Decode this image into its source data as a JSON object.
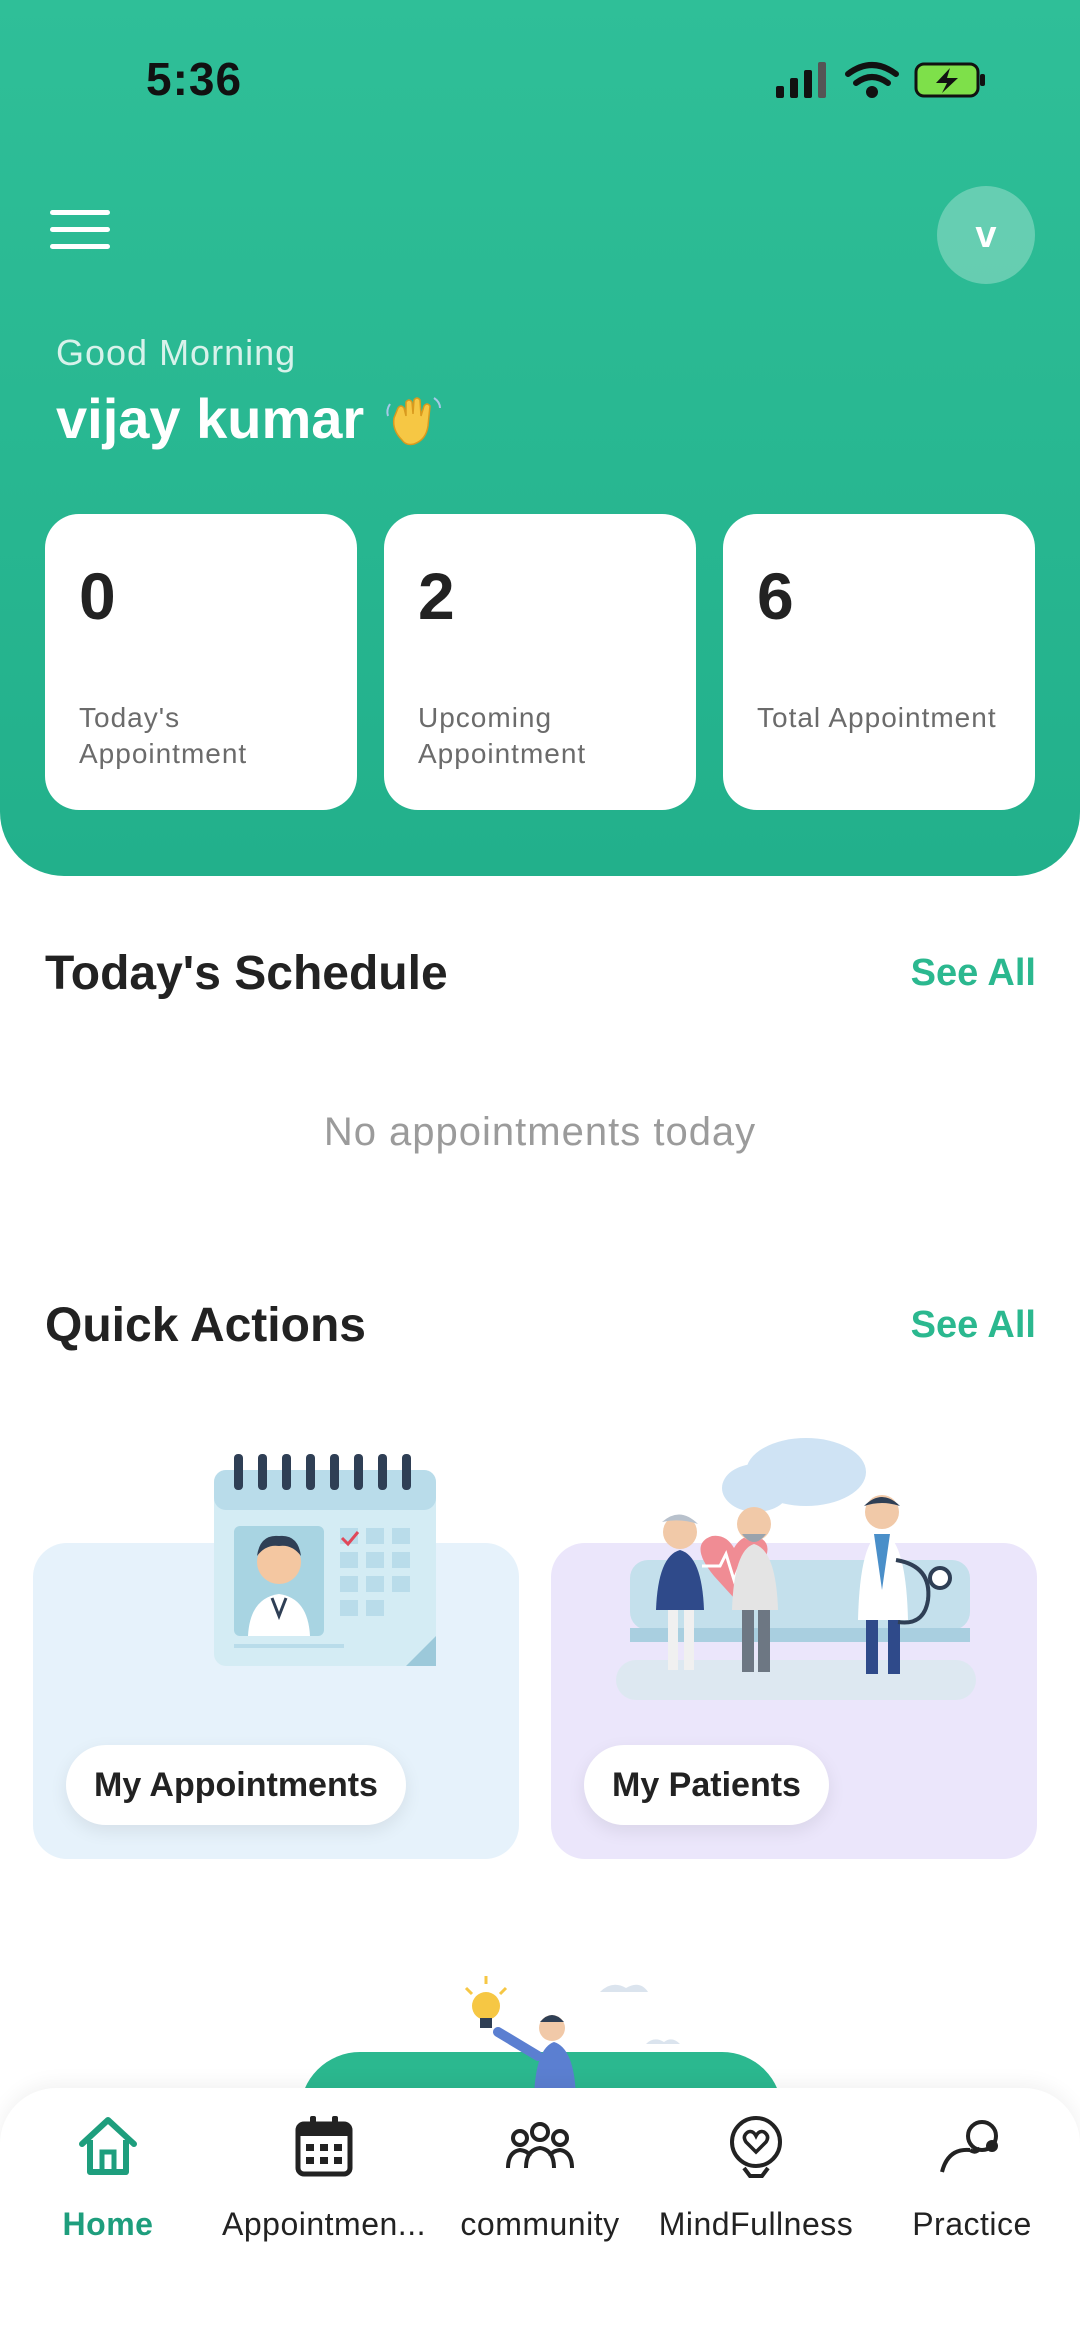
{
  "status": {
    "time": "5:36"
  },
  "header": {
    "avatar_initial": "v",
    "greeting": "Good Morning",
    "user_name": "vijay kumar"
  },
  "stats": [
    {
      "value": "0",
      "label": "Today's Appointment"
    },
    {
      "value": "2",
      "label": "Upcoming Appointment"
    },
    {
      "value": "6",
      "label": "Total Appointment"
    }
  ],
  "schedule": {
    "title": "Today's Schedule",
    "see_all": "See All",
    "empty_text": "No appointments today"
  },
  "quick_actions": {
    "title": "Quick Actions",
    "see_all": "See All",
    "items": [
      {
        "label": "My Appointments",
        "icon": "doctor-calendar-illustration",
        "bg": "#e6f2fb"
      },
      {
        "label": "My Patients",
        "icon": "patients-illustration",
        "bg": "#ebe6fb"
      }
    ]
  },
  "tabbar": {
    "active": "Home",
    "accent": "#1e9e7d",
    "items": [
      {
        "label": "Home",
        "icon": "home-icon"
      },
      {
        "label": "Appointmen...",
        "icon": "calendar-icon"
      },
      {
        "label": "community",
        "icon": "community-icon"
      },
      {
        "label": "MindFullness",
        "icon": "mindfulness-icon"
      },
      {
        "label": "Practice",
        "icon": "practice-icon"
      }
    ]
  }
}
